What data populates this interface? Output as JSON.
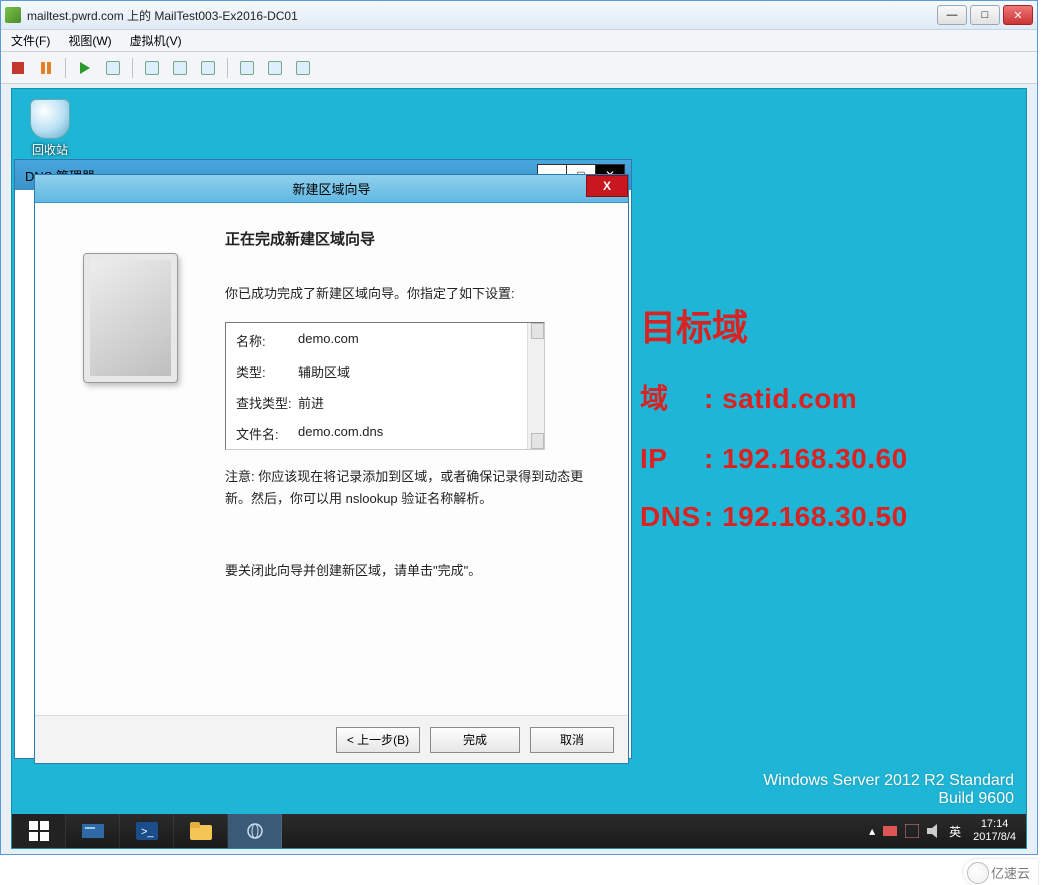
{
  "outer": {
    "title": "mailtest.pwrd.com 上的 MailTest003-Ex2016-DC01",
    "menu": {
      "file": "文件(F)",
      "view": "视图(W)",
      "vm": "虚拟机(V)"
    }
  },
  "desktop": {
    "recycle": "回收站",
    "server_line1": "Windows Server 2012 R2 Standard",
    "server_line2": "Build 9600"
  },
  "dns": {
    "title": "DNS 管理器"
  },
  "wizard": {
    "title": "新建区域向导",
    "heading": "正在完成新建区域向导",
    "intro": "你已成功完成了新建区域向导。你指定了如下设置:",
    "summary": {
      "name_k": "名称:",
      "name_v": "demo.com",
      "type_k": "类型:",
      "type_v": "辅助区域",
      "lookup_k": "查找类型:",
      "lookup_v": "前进",
      "file_k": "文件名:",
      "file_v": "demo.com.dns"
    },
    "note": "注意: 你应该现在将记录添加到区域，或者确保记录得到动态更新。然后，你可以用 nslookup 验证名称解析。",
    "close_hint": "要关闭此向导并创建新区域，请单击\"完成\"。",
    "buttons": {
      "back": "< 上一步(B)",
      "finish": "完成",
      "cancel": "取消"
    }
  },
  "annotation": {
    "title": "目标域",
    "rows": [
      {
        "k": "域",
        "v": ": satid.com"
      },
      {
        "k": "IP",
        "v": ": 192.168.30.60"
      },
      {
        "k": "DNS",
        "v": ": 192.168.30.50"
      }
    ]
  },
  "taskbar": {
    "ime": "英",
    "clock_time": "17:14",
    "clock_date": "2017/8/4"
  },
  "watermark": "亿速云"
}
